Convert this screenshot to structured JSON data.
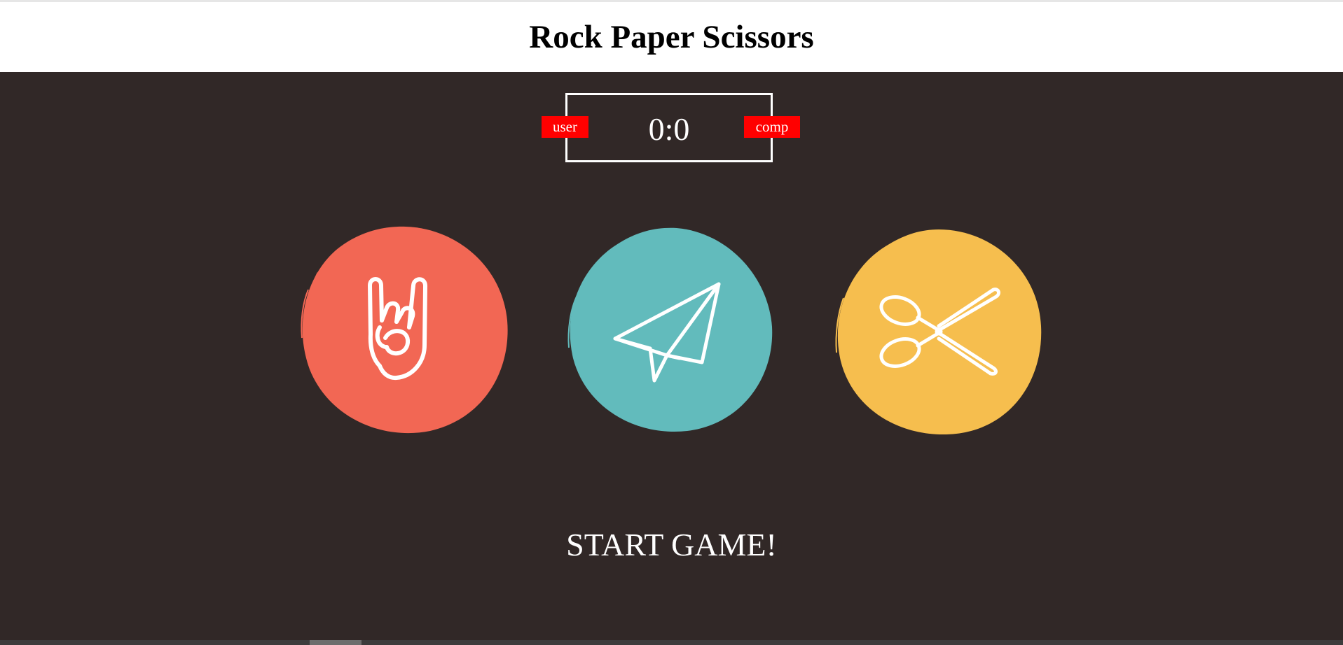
{
  "header": {
    "title": "Rock Paper Scissors"
  },
  "scoreboard": {
    "score": "0:0",
    "user_label": "user",
    "comp_label": "comp"
  },
  "choices": [
    {
      "id": "rock",
      "icon": "rock-hand-icon",
      "color": "#f26754"
    },
    {
      "id": "paper",
      "icon": "paper-plane-icon",
      "color": "#62bbbc"
    },
    {
      "id": "scissors",
      "icon": "scissors-icon",
      "color": "#f6be4e"
    }
  ],
  "message": "START GAME!",
  "colors": {
    "background": "#312827",
    "badge": "#ff0000"
  }
}
